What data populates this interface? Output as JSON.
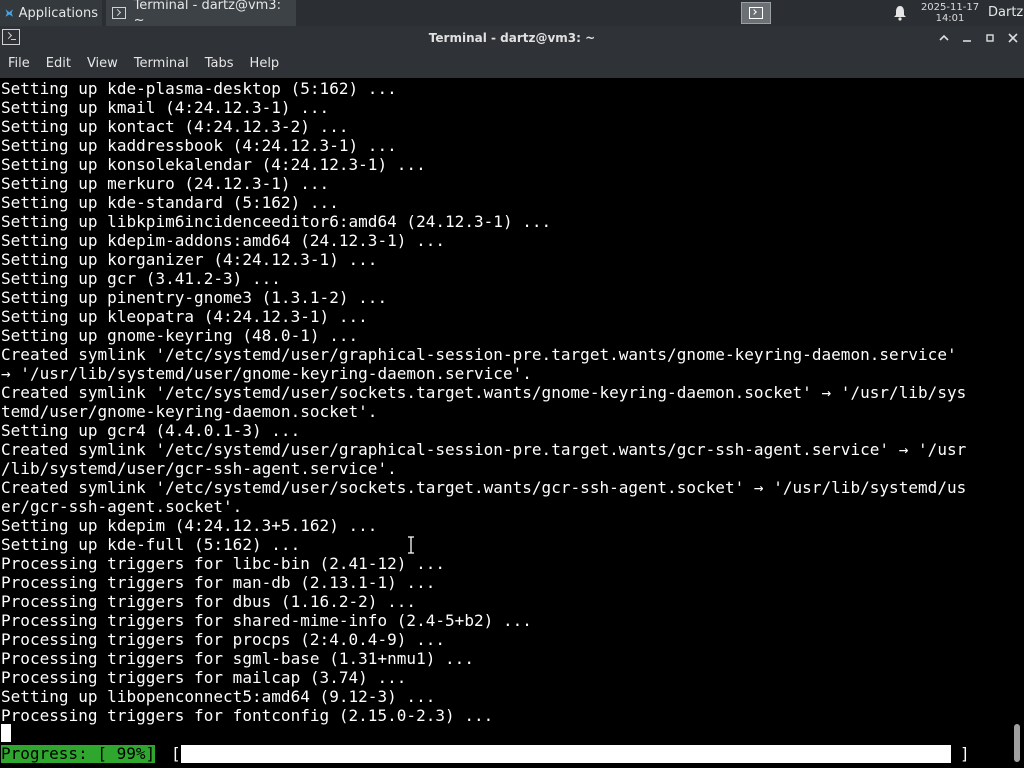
{
  "panel": {
    "applications_label": "Applications",
    "task_label": "Terminal - dartz@vm3: ~",
    "clock_date": "2025-11-17",
    "clock_time": "14:01",
    "user": "Dartz"
  },
  "window": {
    "title": "Terminal - dartz@vm3: ~"
  },
  "menu": {
    "items": [
      "File",
      "Edit",
      "View",
      "Terminal",
      "Tabs",
      "Help"
    ]
  },
  "terminal": {
    "lines": [
      "Setting up kde-plasma-desktop (5:162) ...",
      "Setting up kmail (4:24.12.3-1) ...",
      "Setting up kontact (4:24.12.3-2) ...",
      "Setting up kaddressbook (4:24.12.3-1) ...",
      "Setting up konsolekalendar (4:24.12.3-1) ...",
      "Setting up merkuro (24.12.3-1) ...",
      "Setting up kde-standard (5:162) ...",
      "Setting up libkpim6incidenceeditor6:amd64 (24.12.3-1) ...",
      "Setting up kdepim-addons:amd64 (24.12.3-1) ...",
      "Setting up korganizer (4:24.12.3-1) ...",
      "Setting up gcr (3.41.2-3) ...",
      "Setting up pinentry-gnome3 (1.3.1-2) ...",
      "Setting up kleopatra (4:24.12.3-1) ...",
      "Setting up gnome-keyring (48.0-1) ...",
      "Created symlink '/etc/systemd/user/graphical-session-pre.target.wants/gnome-keyring-daemon.service'",
      "→ '/usr/lib/systemd/user/gnome-keyring-daemon.service'.",
      "Created symlink '/etc/systemd/user/sockets.target.wants/gnome-keyring-daemon.socket' → '/usr/lib/sys",
      "temd/user/gnome-keyring-daemon.socket'.",
      "Setting up gcr4 (4.4.0.1-3) ...",
      "Created symlink '/etc/systemd/user/graphical-session-pre.target.wants/gcr-ssh-agent.service' → '/usr",
      "/lib/systemd/user/gcr-ssh-agent.service'.",
      "Created symlink '/etc/systemd/user/sockets.target.wants/gcr-ssh-agent.socket' → '/usr/lib/systemd/us",
      "er/gcr-ssh-agent.socket'.",
      "Setting up kdepim (4:24.12.3+5.162) ...",
      "Setting up kde-full (5:162) ...",
      "Processing triggers for libc-bin (2.41-12) ...",
      "Processing triggers for man-db (2.13.1-1) ...",
      "Processing triggers for dbus (1.16.2-2) ...",
      "Processing triggers for shared-mime-info (2.4-5+b2) ...",
      "Processing triggers for procps (2:4.0.4-9) ...",
      "Processing triggers for sgml-base (1.31+nmu1) ...",
      "Processing triggers for mailcap (3.74) ...",
      "Setting up libopenconnect5:amd64 (9.12-3) ...",
      "Processing triggers for fontconfig (2.15.0-2.3) ..."
    ],
    "progress_label": "Progress: [ 99%]",
    "progress_open": "[",
    "progress_close": "]",
    "progress_value": 0.99
  },
  "colors": {
    "panel_bg": "#2b2f33",
    "terminal_bg": "#000000",
    "terminal_fg": "#ffffff",
    "progress_green": "#2fa72f"
  }
}
